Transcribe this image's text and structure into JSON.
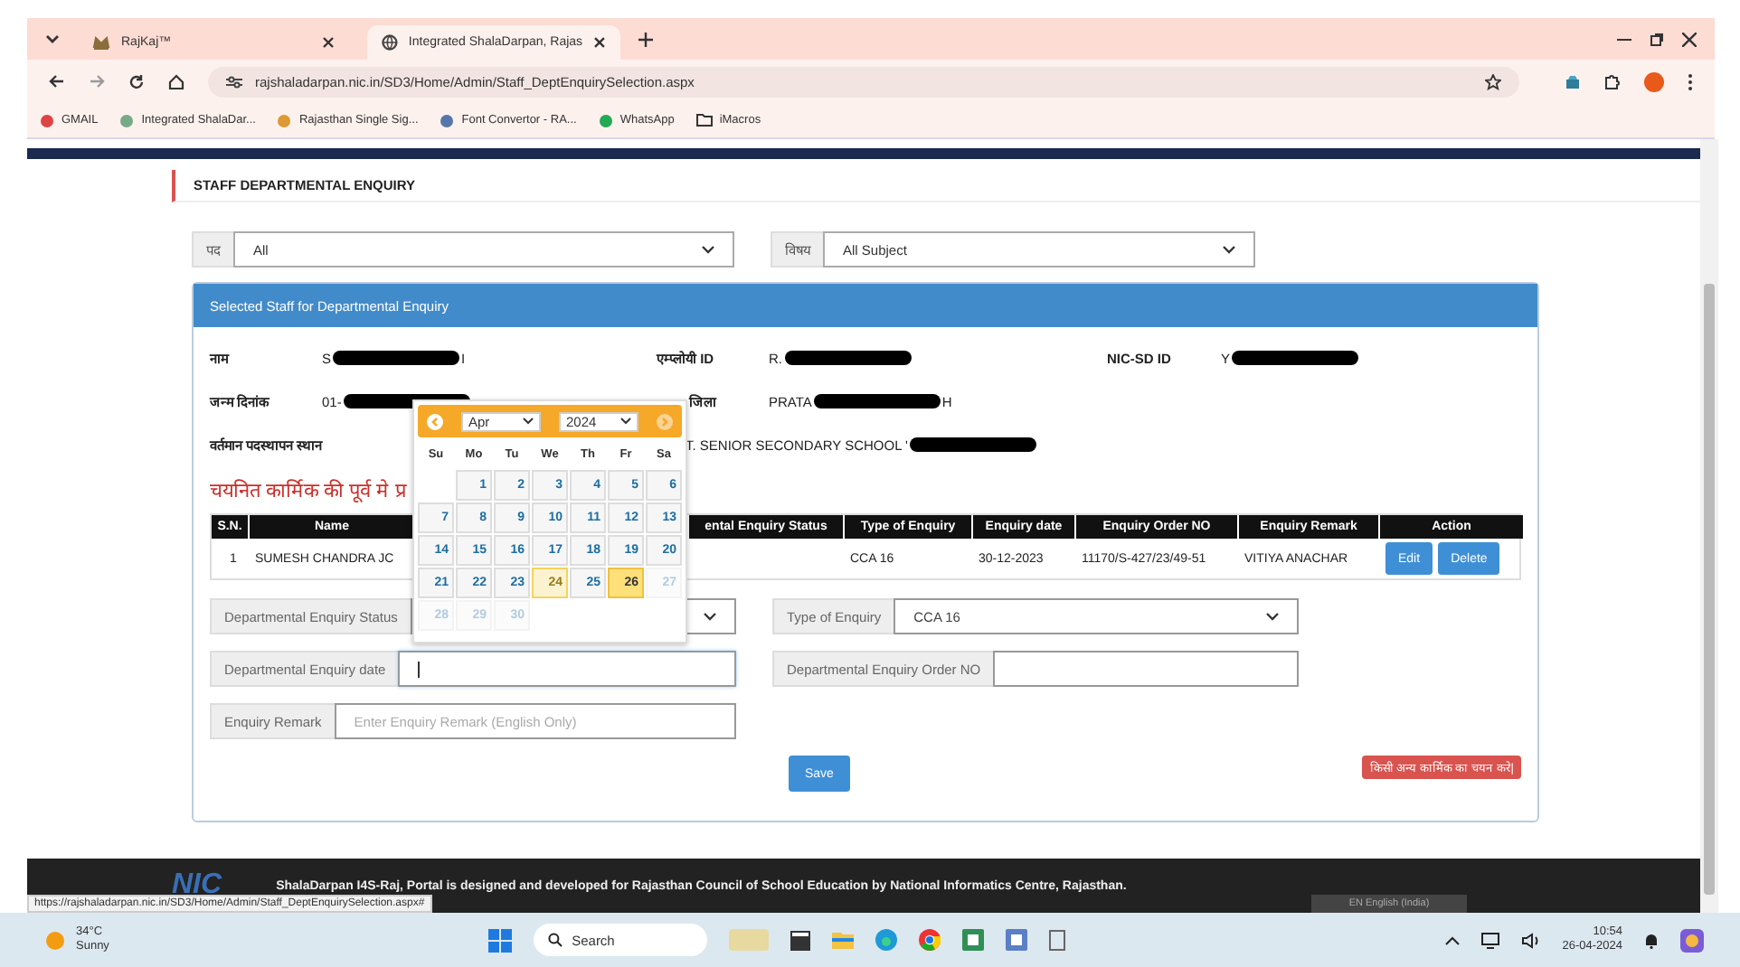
{
  "browser": {
    "tabs": [
      {
        "title": "RajKaj™",
        "selected": false
      },
      {
        "title": "Integrated ShalaDarpan, Rajas",
        "selected": true
      }
    ],
    "address": "rajshaladarpan.nic.in/SD3/Home/Admin/Staff_DeptEnquirySelection.aspx",
    "bookmarks": [
      "GMAIL",
      "Integrated ShalaDar...",
      "Rajasthan Single Sig...",
      "Font Convertor - RA...",
      "WhatsApp",
      "iMacros"
    ]
  },
  "page": {
    "title": "STAFF DEPARTMENTAL ENQUIRY",
    "filters": [
      {
        "label": "पद",
        "value": "All"
      },
      {
        "label": "विषय",
        "value": "All Subject"
      }
    ],
    "panel": {
      "title": "Selected Staff for Departmental Enquiry",
      "details": [
        {
          "label": "नाम",
          "before": "S",
          "redacted": true,
          "after": "I"
        },
        {
          "label": "एम्प्लोयी ID",
          "before": "R.",
          "redacted": true
        },
        {
          "label": "NIC-SD ID",
          "before": "Y",
          "redacted": true
        },
        {
          "label": "जन्म दिनांक",
          "before": "01-",
          "redacted": true
        },
        {
          "label": "जिला",
          "before": "PRATA",
          "redacted": true,
          "after": "H"
        },
        {
          "label": "वर्तमान पदस्थापन स्थान",
          "before": "T. SENIOR SECONDARY SCHOOL '",
          "redacted": true
        }
      ],
      "history_heading": "चयनित कार्मिक की पूर्व मे प्र",
      "table": {
        "columns": [
          "S.N.",
          "Name",
          "ental Enquiry Status",
          "Type of Enquiry",
          "Enquiry date",
          "Enquiry Order NO",
          "Enquiry Remark",
          "Action"
        ],
        "rows": [
          {
            "sn": "1",
            "name": "SUMESH CHANDRA JC",
            "type": "CCA 16",
            "date": "30-12-2023",
            "order_no": "11170/S-427/23/49-51",
            "remark": "VITIYA ANACHAR",
            "actions": [
              "Edit",
              "Delete"
            ]
          }
        ]
      },
      "fields": [
        {
          "label": "Departmental Enquiry Status",
          "kind": "select"
        },
        {
          "label": "Type of Enquiry",
          "kind": "select",
          "value": "CCA 16"
        },
        {
          "label": "Departmental Enquiry date",
          "kind": "input",
          "focused": true
        },
        {
          "label": "Departmental Enquiry Order NO",
          "kind": "input",
          "focused": false
        },
        {
          "label": "Enquiry Remark",
          "kind": "input",
          "focused": false,
          "placeholder": "Enter Enquiry Remark (English Only)"
        }
      ],
      "save": "Save",
      "alert": "किसी अन्य कार्मिक का चयन करे|"
    },
    "datepicker": {
      "month": "Apr",
      "year": "2024",
      "weekdays": [
        "Su",
        "Mo",
        "Tu",
        "We",
        "Th",
        "Fr",
        "Sa"
      ],
      "weeks": [
        [
          {
            "day": "1",
            "kind": "normal"
          },
          {
            "day": "2",
            "kind": "normal"
          },
          {
            "day": "3",
            "kind": "normal"
          },
          {
            "day": "4",
            "kind": "normal"
          },
          {
            "day": "5",
            "kind": "normal"
          },
          {
            "day": "6",
            "kind": "normal"
          }
        ],
        [
          {
            "day": "7",
            "kind": "normal"
          },
          {
            "day": "8",
            "kind": "normal"
          },
          {
            "day": "9",
            "kind": "normal"
          },
          {
            "day": "10",
            "kind": "normal"
          },
          {
            "day": "11",
            "kind": "normal"
          },
          {
            "day": "12",
            "kind": "normal"
          },
          {
            "day": "13",
            "kind": "normal"
          }
        ],
        [
          {
            "day": "14",
            "kind": "normal"
          },
          {
            "day": "15",
            "kind": "normal"
          },
          {
            "day": "16",
            "kind": "normal"
          },
          {
            "day": "17",
            "kind": "normal"
          },
          {
            "day": "18",
            "kind": "normal"
          },
          {
            "day": "19",
            "kind": "normal"
          },
          {
            "day": "20",
            "kind": "normal"
          }
        ],
        [
          {
            "day": "21",
            "kind": "normal"
          },
          {
            "day": "22",
            "kind": "normal"
          },
          {
            "day": "23",
            "kind": "normal"
          },
          {
            "day": "24",
            "kind": "highlight"
          },
          {
            "day": "25",
            "kind": "normal"
          },
          {
            "day": "26",
            "kind": "today"
          },
          {
            "day": "27",
            "kind": "disabled"
          }
        ],
        [
          {
            "day": "28",
            "kind": "disabled"
          },
          {
            "day": "29",
            "kind": "disabled"
          },
          {
            "day": "30",
            "kind": "disabled"
          }
        ]
      ]
    },
    "footer": {
      "logo": "NIC",
      "text": "ShalaDarpan I4S-Raj, Portal is designed and developed for Rajasthan Council of School Education by National Informatics Centre, Rajasthan.",
      "language": "EN English (India)"
    },
    "status_url": "https://rajshaladarpan.nic.in/SD3/Home/Admin/Staff_DeptEnquirySelection.aspx#"
  },
  "taskbar": {
    "temperature": "34°C",
    "condition": "Sunny",
    "search": "Search",
    "time": "10:54",
    "date": "26-04-2024"
  }
}
